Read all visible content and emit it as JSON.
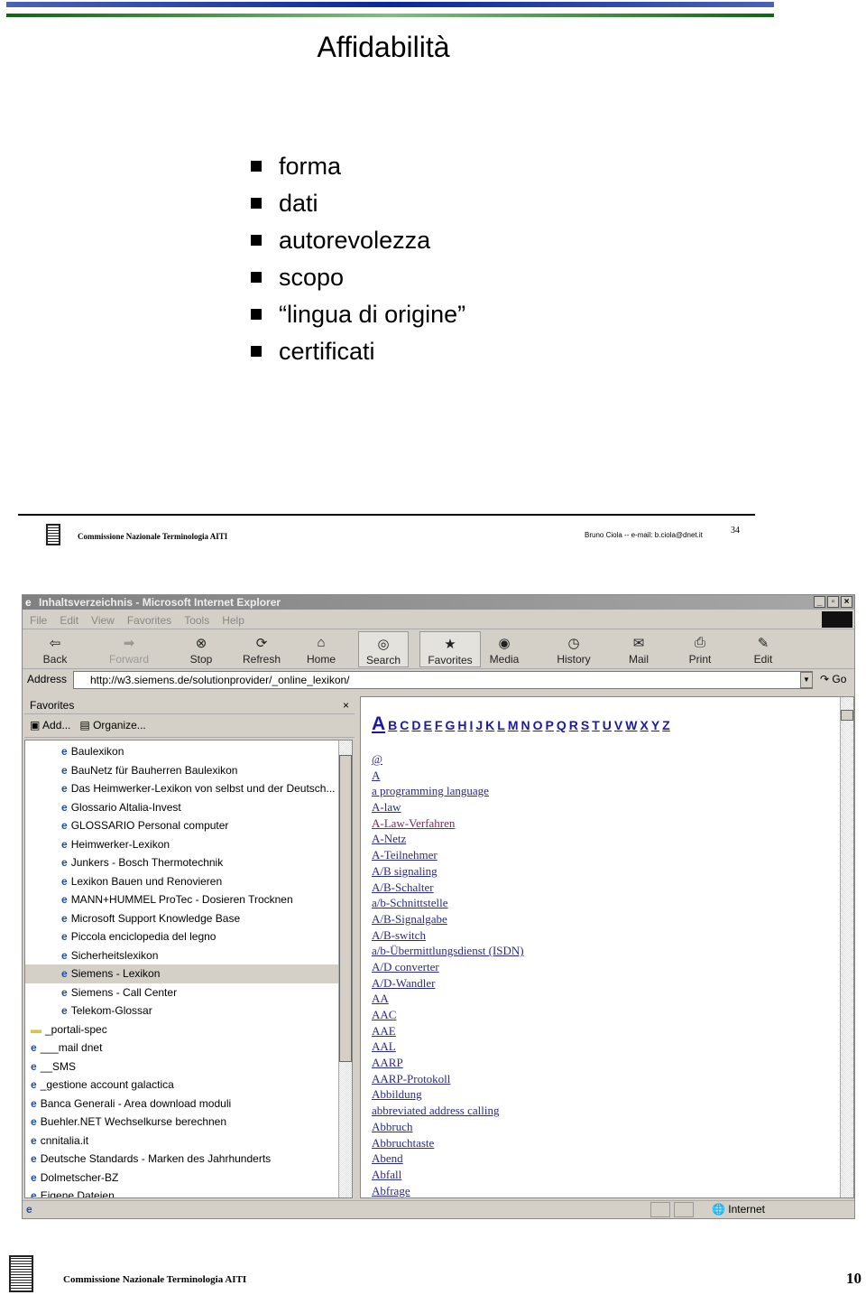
{
  "slide": {
    "title": "Affidabilità",
    "bullets": [
      "forma",
      "dati",
      "autorevolezza",
      "scopo",
      "“lingua di origine”",
      "certificati"
    ],
    "footer_org": "Commissione Nazionale Terminologia AITI",
    "footer_author": "Bruno Ciola  -- e-mail: b.ciola@dnet.it",
    "slide_number": "34"
  },
  "browser": {
    "window_title": "Inhaltsverzeichnis - Microsoft Internet Explorer",
    "menu": [
      "File",
      "Edit",
      "View",
      "Favorites",
      "Tools",
      "Help"
    ],
    "toolbar": [
      "Back",
      "Forward",
      "Stop",
      "Refresh",
      "Home",
      "Search",
      "Favorites",
      "Media",
      "History",
      "Mail",
      "Print",
      "Edit"
    ],
    "address_label": "Address",
    "address": "http://w3.siemens.de/solutionprovider/_online_lexikon/",
    "go": "Go",
    "favorites": {
      "title": "Favorites",
      "add": "Add...",
      "organize": "Organize...",
      "sub_items": [
        "Baulexikon",
        "BauNetz für Bauherren Baulexikon",
        "Das Heimwerker-Lexikon von selbst und der Deutsch...",
        "Glossario Altalia-Invest",
        "GLOSSARIO Personal computer",
        "Heimwerker-Lexikon",
        "Junkers - Bosch Thermotechnik",
        "Lexikon Bauen und Renovieren",
        "MANN+HUMMEL ProTec - Dosieren Trocknen",
        "Microsoft Support Knowledge Base",
        "Piccola enciclopedia del legno",
        "Sicherheitslexikon",
        "Siemens - Lexikon",
        "Siemens - Call Center",
        "Telekom-Glossar"
      ],
      "selected": "Siemens - Lexikon",
      "items": [
        "_portali-spec",
        "___mail dnet",
        "__SMS",
        "_gestione account galactica",
        "Banca Generali - Area download moduli",
        "Buehler.NET Wechselkurse berechnen",
        "cnnitalia.it",
        "Deutsche Standards - Marken des Jahrhunderts",
        "Dolmetscher-BZ",
        "Eigene Dateien"
      ]
    },
    "alphabet": [
      "A",
      "B",
      "C",
      "D",
      "E",
      "F",
      "G",
      "H",
      "I",
      "J",
      "K",
      "L",
      "M",
      "N",
      "O",
      "P",
      "Q",
      "R",
      "S",
      "T",
      "U",
      "V",
      "W",
      "X",
      "Y",
      "Z"
    ],
    "links": [
      "@",
      "A",
      "a programming language",
      "A-law",
      "A-Law-Verfahren",
      "A-Netz",
      "A-Teilnehmer",
      "A/B signaling",
      "A/B-Schalter",
      "a/b-Schnittstelle",
      "A/B-Signalgabe",
      "A/B-switch",
      "a/b-Übermittlungsdienst (ISDN)",
      "A/D converter",
      "A/D-Wandler",
      "AA",
      "AAC",
      "AAE",
      "AAL",
      "AARP",
      "AARP-Protokoll",
      "Abbildung",
      "abbreviated address calling",
      "Abbruch",
      "Abbruchtaste",
      "Abend",
      "Abfall",
      "Abfrage"
    ],
    "visited_link": "A-Law-Verfahren",
    "status_zone": "Internet"
  },
  "page_footer": {
    "org": "Commissione Nazionale Terminologia AITI",
    "page_number": "10"
  }
}
